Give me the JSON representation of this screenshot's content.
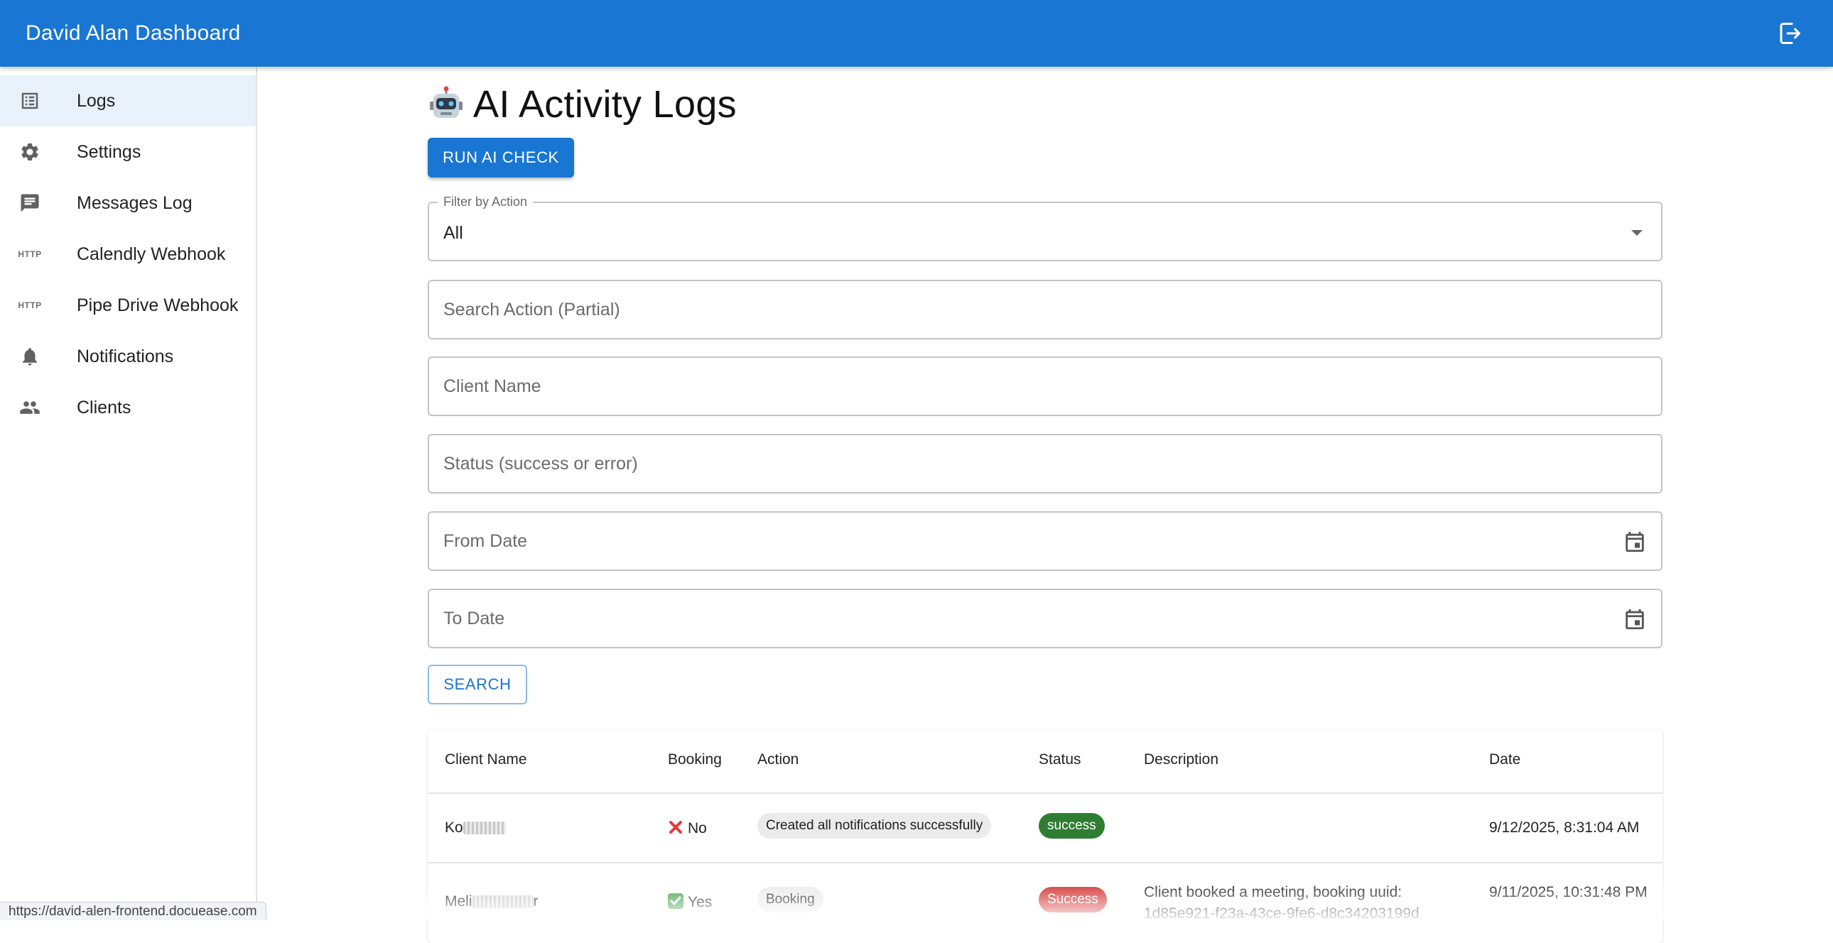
{
  "app": {
    "title": "David Alan Dashboard"
  },
  "sidebar": {
    "items": [
      {
        "label": "Logs",
        "icon": "list-icon",
        "active": true
      },
      {
        "label": "Settings",
        "icon": "gear-icon"
      },
      {
        "label": "Messages Log",
        "icon": "message-icon"
      },
      {
        "label": "Calendly Webhook",
        "icon": "http-icon"
      },
      {
        "label": "Pipe Drive Webhook",
        "icon": "http-icon"
      },
      {
        "label": "Notifications",
        "icon": "bell-icon"
      },
      {
        "label": "Clients",
        "icon": "people-icon"
      }
    ],
    "http_badge": "HTTP"
  },
  "page": {
    "title": "AI Activity Logs",
    "run_button": "RUN AI CHECK",
    "search_button": "SEARCH"
  },
  "filters": {
    "action_label": "Filter by Action",
    "action_value": "All",
    "search_action_placeholder": "Search Action (Partial)",
    "client_name_placeholder": "Client Name",
    "status_placeholder": "Status (success or error)",
    "from_date_placeholder": "From Date",
    "to_date_placeholder": "To Date"
  },
  "table": {
    "headers": [
      "Client Name",
      "Booking",
      "Action",
      "Status",
      "Description",
      "Date"
    ],
    "rows": [
      {
        "client_name": "Ko",
        "booking": "No",
        "booking_ok": false,
        "action": "Created all notifications successfully",
        "status": "success",
        "description": "",
        "date": "9/12/2025, 8:31:04 AM"
      },
      {
        "client_name": "Meli",
        "client_suffix": "r",
        "booking": "Yes",
        "booking_ok": true,
        "action": "Booking",
        "status": "Success",
        "description": "Client booked a meeting, booking uuid: 1d85e921-f23a-43ce-9fe6-d8c34203199d",
        "date": "9/11/2025, 10:31:48 PM"
      }
    ]
  },
  "status_bar": {
    "url": "https://david-alen-frontend.docuease.com"
  },
  "colors": {
    "primary": "#1976d2",
    "success_green": "#2e7d32",
    "error_red": "#d32f2f",
    "active_nav": "#e9f1fb"
  }
}
